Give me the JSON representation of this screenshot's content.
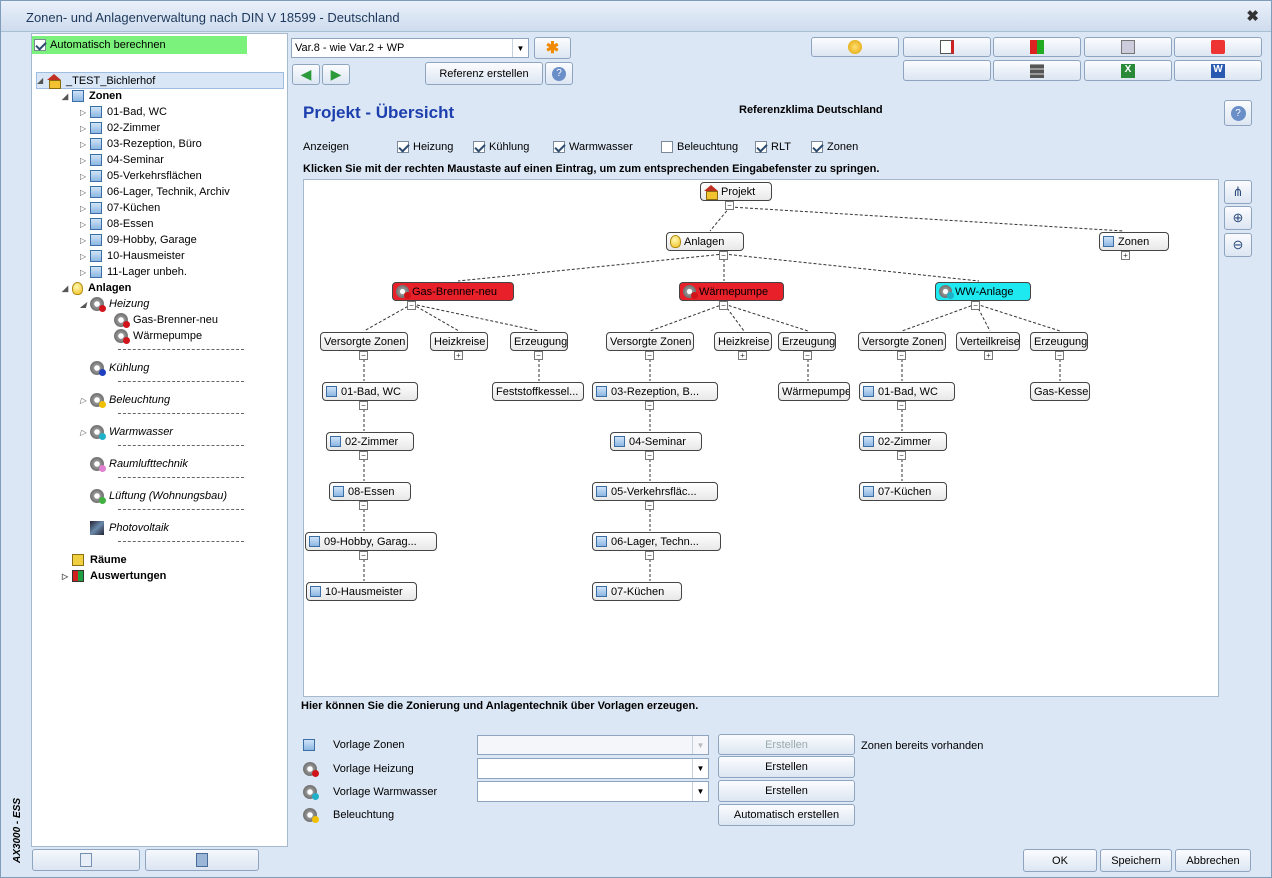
{
  "window": {
    "title": "Zonen- und Anlagenverwaltung nach DIN V 18599 - Deutschland",
    "close": "✖"
  },
  "sidebar_vertical": "AX3000 - ESS",
  "auto_calc": {
    "label": "Automatisch berechnen",
    "checked": true
  },
  "tree": {
    "root": "_TEST_Bichlerhof",
    "zonen_label": "Zonen",
    "zones": [
      "01-Bad, WC",
      "02-Zimmer",
      "03-Rezeption, Büro",
      "04-Seminar",
      "05-Verkehrsflächen",
      "06-Lager, Technik, Archiv",
      "07-Küchen",
      "08-Essen",
      "09-Hobby, Garage",
      "10-Hausmeister",
      "11-Lager unbeh."
    ],
    "anlagen_label": "Anlagen",
    "heizung": "Heizung",
    "heizung_items": [
      "Gas-Brenner-neu",
      "Wärmepumpe"
    ],
    "kuehlung": "Kühlung",
    "beleuchtung": "Beleuchtung",
    "warmwasser": "Warmwasser",
    "raumluft": "Raumlufttechnik",
    "lueftung": "Lüftung (Wohnungsbau)",
    "photovoltaik": "Photovoltaik",
    "raeume": "Räume",
    "auswertungen": "Auswertungen"
  },
  "variant": {
    "value": "Var.8 - wie Var.2 + WP"
  },
  "referenz_button": "Referenz erstellen",
  "page": {
    "title": "Projekt - Übersicht",
    "klima": "Referenzklima Deutschland"
  },
  "anzeigen": {
    "label": "Anzeigen",
    "options": [
      {
        "label": "Heizung",
        "checked": true
      },
      {
        "label": "Kühlung",
        "checked": true
      },
      {
        "label": "Warmwasser",
        "checked": true
      },
      {
        "label": "Beleuchtung",
        "checked": false
      },
      {
        "label": "RLT",
        "checked": true
      },
      {
        "label": "Zonen",
        "checked": true
      }
    ]
  },
  "hint": "Klicken Sie mit der rechten Maustaste auf einen Eintrag, um zum entsprechenden Eingabefenster zu springen.",
  "diagram": {
    "projekt": "Projekt",
    "anlagen": "Anlagen",
    "zonen": "Zonen",
    "gas": "Gas-Brenner-neu",
    "wp": "Wärmepumpe",
    "ww": "WW-Anlage",
    "versorgte": "Versorgte Zonen",
    "heizkreise": "Heizkreise",
    "erzeugung": "Erzeugung",
    "verteilkreise": "Verteilkreise",
    "gas_zones": [
      "01-Bad, WC",
      "02-Zimmer",
      "08-Essen",
      "09-Hobby, Garag...",
      "10-Hausmeister"
    ],
    "gas_erz": "Feststoffkessel...",
    "wp_zones": [
      "03-Rezeption, B...",
      "04-Seminar",
      "05-Verkehrsfläc...",
      "06-Lager, Techn...",
      "07-Küchen"
    ],
    "wp_erz": "Wärmepumpe",
    "ww_zones": [
      "01-Bad, WC",
      "02-Zimmer",
      "07-Küchen"
    ],
    "ww_erz": "Gas-Kessel"
  },
  "vorlagen": {
    "heading": "Hier können Sie die Zonierung und Anlagentechnik über Vorlagen erzeugen.",
    "zonen": {
      "label": "Vorlage Zonen",
      "button": "Erstellen",
      "note": "Zonen bereits vorhanden"
    },
    "heizung": {
      "label": "Vorlage Heizung",
      "button": "Erstellen"
    },
    "warmwasser": {
      "label": "Vorlage Warmwasser",
      "button": "Erstellen"
    },
    "beleuchtung": {
      "label": "Beleuchtung",
      "button": "Automatisch erstellen"
    }
  },
  "footer": {
    "ok": "OK",
    "save": "Speichern",
    "cancel": "Abbrechen"
  }
}
